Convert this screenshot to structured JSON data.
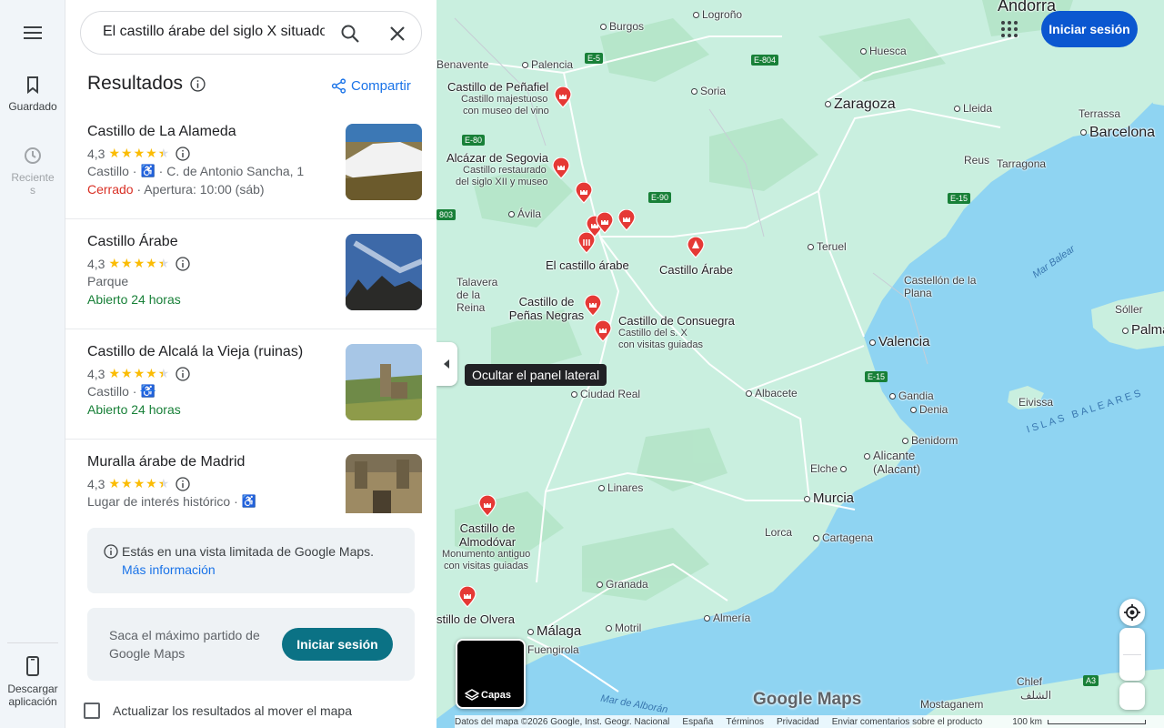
{
  "rail": {
    "saved_label": "Guardado",
    "recent_label_1": "Reciente",
    "recent_label_2": "s",
    "download_label_1": "Descargar",
    "download_label_2": "aplicación"
  },
  "search": {
    "value": "El castillo árabe del siglo X situado en"
  },
  "panel": {
    "results_title": "Resultados",
    "share_label": "Compartir"
  },
  "results": [
    {
      "name": "Castillo de La Alameda",
      "rating": "4,3",
      "stars": 4.3,
      "category": "Castillo",
      "address": "C. de Antonio Sancha, 1",
      "status": "Cerrado",
      "status_extra": "· Apertura: 10:00 (sáb)",
      "status_type": "closed"
    },
    {
      "name": "Castillo Árabe",
      "rating": "4,3",
      "stars": 4.3,
      "category": "Parque",
      "address": "",
      "status": "Abierto 24 horas",
      "status_extra": "",
      "status_type": "open"
    },
    {
      "name": "Castillo de Alcalá la Vieja (ruinas)",
      "rating": "4,3",
      "stars": 4.3,
      "category": "Castillo",
      "address": "",
      "status": "Abierto 24 horas",
      "status_extra": "",
      "status_type": "open"
    },
    {
      "name": "Muralla árabe de Madrid",
      "rating": "4,3",
      "stars": 4.3,
      "category": "Lugar de interés histórico",
      "address": "",
      "status": "",
      "status_extra": "",
      "status_type": ""
    }
  ],
  "limited": {
    "text": "Estás en una vista limitada de Google Maps.",
    "link": "Más información"
  },
  "promo": {
    "text": "Saca el máximo partido de Google Maps",
    "button": "Iniciar sesión"
  },
  "update_checkbox": "Actualizar los resultados al mover el mapa",
  "map": {
    "signin_label": "Iniciar sesión",
    "tooltip": "Ocultar el panel lateral",
    "layers_label": "Capas",
    "logo": "Google Maps",
    "footer": [
      "Datos del mapa ©2026 Google, Inst. Geogr. Nacional",
      "España",
      "Términos",
      "Privacidad",
      "Enviar comentarios sobre el producto"
    ],
    "scale": "100 km",
    "cities": [
      {
        "name": "Andorra",
        "big": true
      },
      {
        "name": "Burgos"
      },
      {
        "name": "Logroño"
      },
      {
        "name": "Benavente"
      },
      {
        "name": "Palencia"
      },
      {
        "name": "Huesca"
      },
      {
        "name": "Soria"
      },
      {
        "name": "Zaragoza",
        "big": true
      },
      {
        "name": "Lleida"
      },
      {
        "name": "Terrassa"
      },
      {
        "name": "Barcelona",
        "big": true
      },
      {
        "name": "Reus"
      },
      {
        "name": "Tarragona"
      },
      {
        "name": "Ávila"
      },
      {
        "name": "Teruel"
      },
      {
        "name": "Talavera de la Reina"
      },
      {
        "name": "Castellón de la Plana"
      },
      {
        "name": "Valencia",
        "big": true
      },
      {
        "name": "Ciudad Real"
      },
      {
        "name": "Albacete"
      },
      {
        "name": "Gandia"
      },
      {
        "name": "Denia"
      },
      {
        "name": "Eivissa"
      },
      {
        "name": "Sóller"
      },
      {
        "name": "Palma",
        "big": true
      },
      {
        "name": "Benidorm"
      },
      {
        "name": "Alicante (Alacant)"
      },
      {
        "name": "Elche"
      },
      {
        "name": "Murcia",
        "big": true
      },
      {
        "name": "Linares"
      },
      {
        "name": "Lorca"
      },
      {
        "name": "Cartagena"
      },
      {
        "name": "Granada"
      },
      {
        "name": "Málaga",
        "big": true
      },
      {
        "name": "Motril"
      },
      {
        "name": "Almería"
      },
      {
        "name": "Fuengirola"
      },
      {
        "name": "Chlef"
      },
      {
        "name": "الشلف"
      },
      {
        "name": "Mostaganem"
      }
    ],
    "seas": [
      "Mar Balear",
      "ISLAS BALEARES",
      "Mar de Alborán"
    ],
    "pois": [
      {
        "title": "Castillo de Peñafiel",
        "sub": [
          "Castillo majestuoso",
          "con museo del vino"
        ]
      },
      {
        "title": "Alcázar de Segovia",
        "sub": [
          "Castillo restaurado",
          "del siglo XII y museo"
        ]
      },
      {
        "title": "El castillo árabe",
        "sub": []
      },
      {
        "title": "Castillo Árabe",
        "sub": []
      },
      {
        "title": "Castillo de Peñas Negras",
        "sub": []
      },
      {
        "title": "Castillo de Consuegra",
        "sub": [
          "Castillo del s. X",
          "con visitas guiadas"
        ]
      },
      {
        "title": "Castillo de Almodóvar",
        "sub": [
          "Monumento antiguo",
          "con visitas guiadas"
        ]
      },
      {
        "title": "stillo de Olvera",
        "sub": []
      }
    ],
    "roads": [
      "E-5",
      "E-804",
      "E-80",
      "E-90",
      "E-15",
      "E-15",
      "A3",
      "803"
    ]
  },
  "colors": {
    "land": "#c9efdf",
    "land_dark": "#b4e4c8",
    "water": "#8fd4f2",
    "pin": "#e53935",
    "accent": "#0b57d0"
  }
}
